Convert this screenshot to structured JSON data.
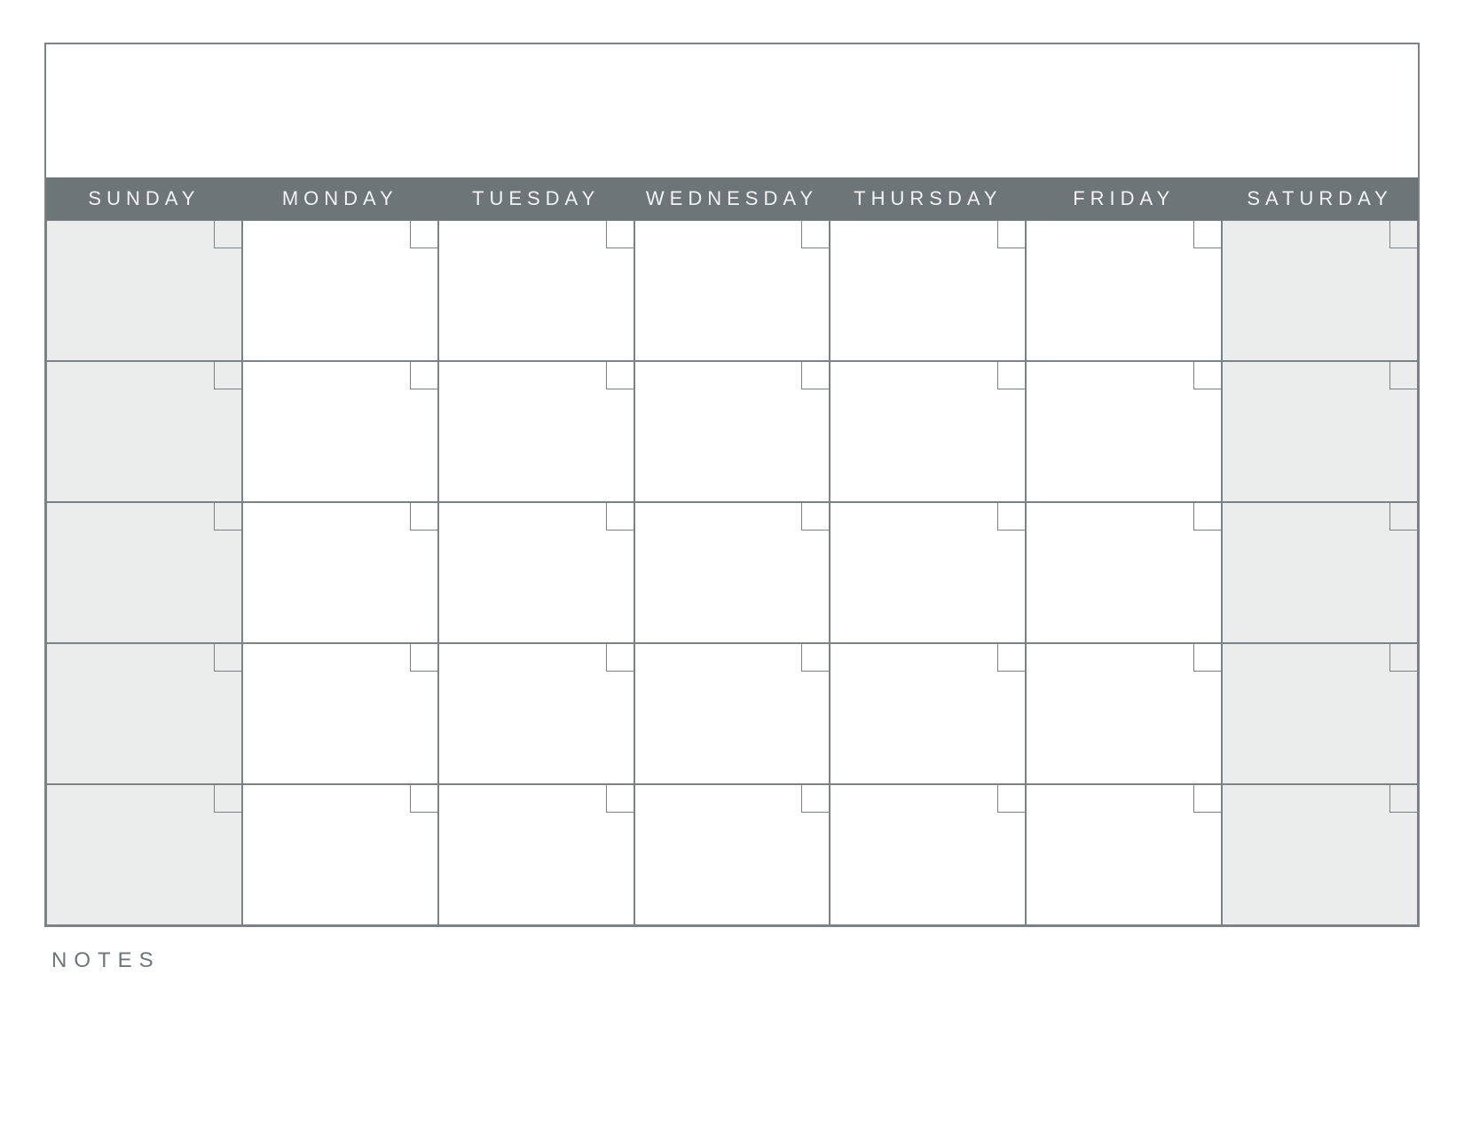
{
  "title": "",
  "days": [
    "SUNDAY",
    "MONDAY",
    "TUESDAY",
    "WEDNESDAY",
    "THURSDAY",
    "FRIDAY",
    "SATURDAY"
  ],
  "weekend_indices": [
    0,
    6
  ],
  "weeks": [
    [
      "",
      "",
      "",
      "",
      "",
      "",
      ""
    ],
    [
      "",
      "",
      "",
      "",
      "",
      "",
      ""
    ],
    [
      "",
      "",
      "",
      "",
      "",
      "",
      ""
    ],
    [
      "",
      "",
      "",
      "",
      "",
      "",
      ""
    ],
    [
      "",
      "",
      "",
      "",
      "",
      "",
      ""
    ]
  ],
  "notes_label": "NOTES"
}
